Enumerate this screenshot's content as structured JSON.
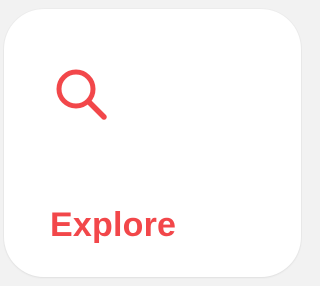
{
  "tile": {
    "label": "Explore",
    "icon": "search-icon",
    "accent_color": "#f2474a"
  }
}
